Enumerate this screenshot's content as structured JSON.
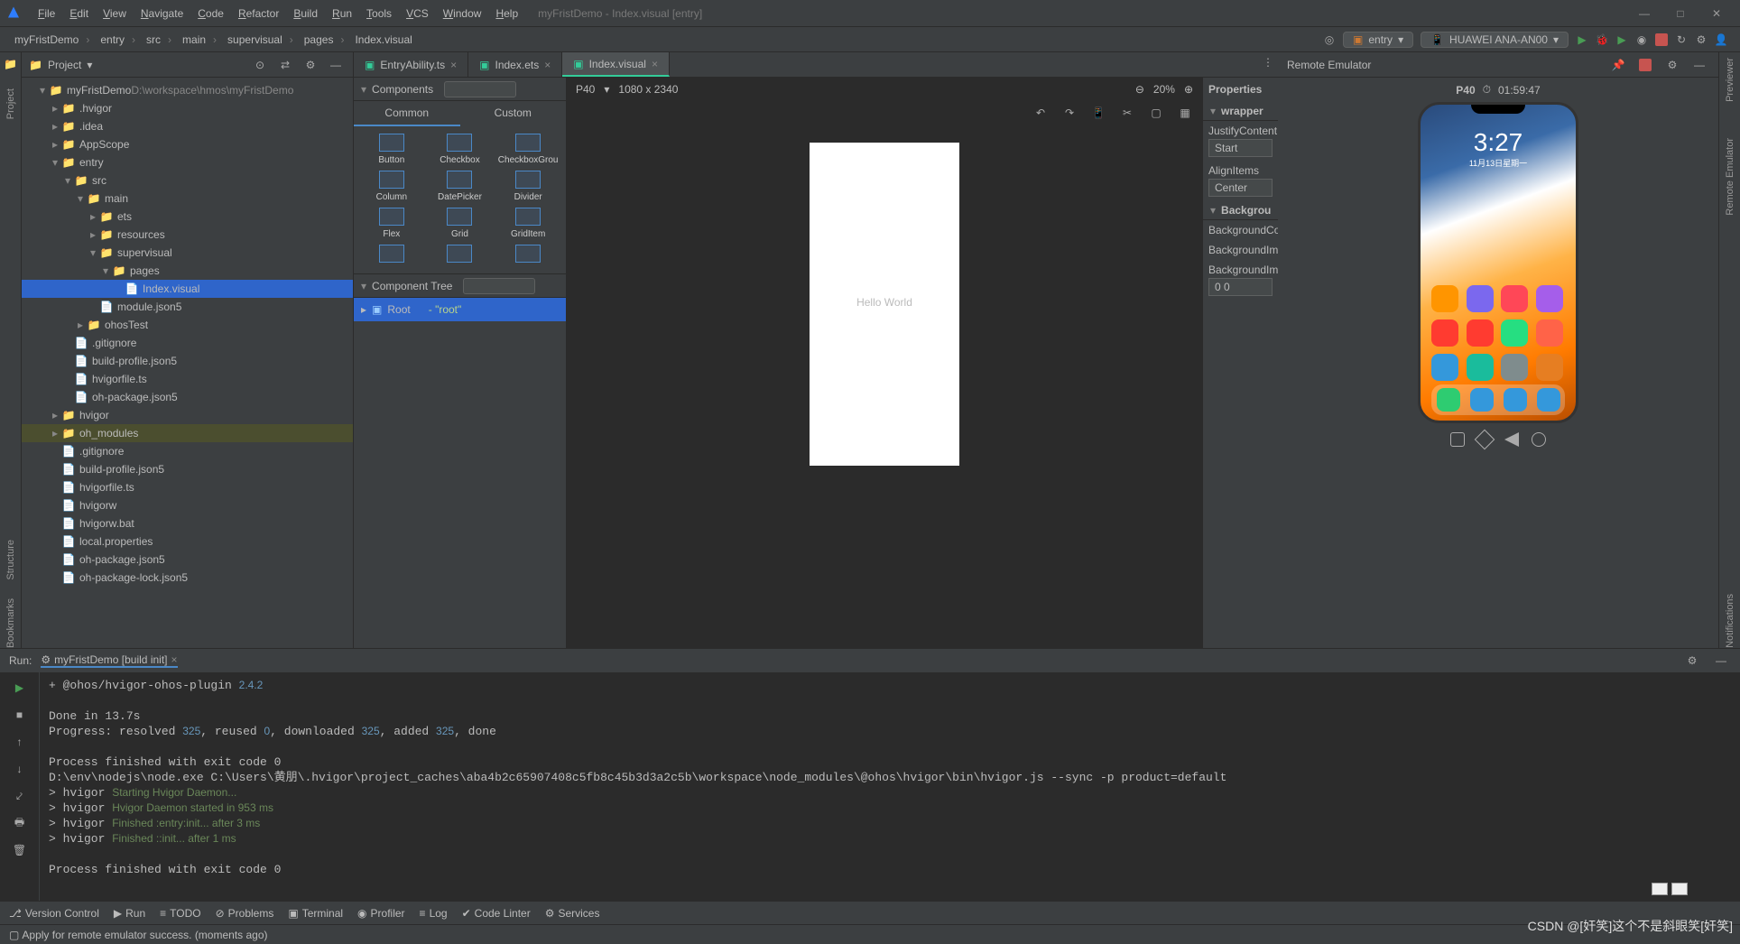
{
  "menubar": {
    "items": [
      "File",
      "Edit",
      "View",
      "Navigate",
      "Code",
      "Refactor",
      "Build",
      "Run",
      "Tools",
      "VCS",
      "Window",
      "Help"
    ],
    "title": "myFristDemo - Index.visual [entry]"
  },
  "breadcrumbs": [
    "myFristDemo",
    "entry",
    "src",
    "main",
    "supervisual",
    "pages",
    "Index.visual"
  ],
  "config": {
    "module": "entry",
    "device": "HUAWEI ANA-AN00"
  },
  "project": {
    "header": "Project",
    "rootLabel": "myFristDemo",
    "rootPath": "D:\\workspace\\hmos\\myFristDemo"
  },
  "tree": [
    {
      "d": 1,
      "tw": "▾",
      "ic": "📁",
      "cls": "c-blue",
      "t": "myFristDemo",
      "suffix": " D:\\workspace\\hmos\\myFristDemo"
    },
    {
      "d": 2,
      "tw": "▸",
      "ic": "📁",
      "t": ".hvigor"
    },
    {
      "d": 2,
      "tw": "▸",
      "ic": "📁",
      "t": ".idea"
    },
    {
      "d": 2,
      "tw": "▸",
      "ic": "📁",
      "t": "AppScope"
    },
    {
      "d": 2,
      "tw": "▾",
      "ic": "📁",
      "cls": "c-blue",
      "t": "entry"
    },
    {
      "d": 3,
      "tw": "▾",
      "ic": "📁",
      "t": "src"
    },
    {
      "d": 4,
      "tw": "▾",
      "ic": "📁",
      "t": "main"
    },
    {
      "d": 5,
      "tw": "▸",
      "ic": "📁",
      "t": "ets"
    },
    {
      "d": 5,
      "tw": "▸",
      "ic": "📁",
      "t": "resources"
    },
    {
      "d": 5,
      "tw": "▾",
      "ic": "📁",
      "t": "supervisual"
    },
    {
      "d": 6,
      "tw": "▾",
      "ic": "📁",
      "t": "pages"
    },
    {
      "d": 7,
      "tw": "",
      "ic": "📄",
      "cls": "c-teal",
      "t": "Index.visual",
      "sel": true
    },
    {
      "d": 5,
      "tw": "",
      "ic": "📄",
      "cls": "c-orange",
      "t": "module.json5"
    },
    {
      "d": 4,
      "tw": "▸",
      "ic": "📁",
      "t": "ohosTest"
    },
    {
      "d": 3,
      "tw": "",
      "ic": "📄",
      "t": ".gitignore"
    },
    {
      "d": 3,
      "tw": "",
      "ic": "📄",
      "cls": "c-orange",
      "t": "build-profile.json5"
    },
    {
      "d": 3,
      "tw": "",
      "ic": "📄",
      "cls": "c-teal",
      "t": "hvigorfile.ts"
    },
    {
      "d": 3,
      "tw": "",
      "ic": "📄",
      "cls": "c-orange",
      "t": "oh-package.json5"
    },
    {
      "d": 2,
      "tw": "▸",
      "ic": "📁",
      "t": "hvigor"
    },
    {
      "d": 2,
      "tw": "▸",
      "ic": "📁",
      "cls": "c-orange",
      "t": "oh_modules",
      "hl": true
    },
    {
      "d": 2,
      "tw": "",
      "ic": "📄",
      "t": ".gitignore"
    },
    {
      "d": 2,
      "tw": "",
      "ic": "📄",
      "cls": "c-orange",
      "t": "build-profile.json5"
    },
    {
      "d": 2,
      "tw": "",
      "ic": "📄",
      "cls": "c-teal",
      "t": "hvigorfile.ts"
    },
    {
      "d": 2,
      "tw": "",
      "ic": "📄",
      "t": "hvigorw"
    },
    {
      "d": 2,
      "tw": "",
      "ic": "📄",
      "t": "hvigorw.bat"
    },
    {
      "d": 2,
      "tw": "",
      "ic": "📄",
      "t": "local.properties"
    },
    {
      "d": 2,
      "tw": "",
      "ic": "📄",
      "cls": "c-orange",
      "t": "oh-package.json5"
    },
    {
      "d": 2,
      "tw": "",
      "ic": "📄",
      "cls": "c-orange",
      "t": "oh-package-lock.json5"
    }
  ],
  "editorTabs": [
    {
      "t": "EntryAbility.ts"
    },
    {
      "t": "Index.ets"
    },
    {
      "t": "Index.visual",
      "active": true
    }
  ],
  "components": {
    "header": "Components",
    "tabs": [
      "Common",
      "Custom"
    ],
    "items": [
      "Button",
      "Checkbox",
      "CheckboxGrou",
      "Column",
      "DatePicker",
      "Divider",
      "Flex",
      "Grid",
      "GridItem",
      "",
      "",
      ""
    ]
  },
  "componentTree": {
    "header": "Component Tree",
    "root": "Root",
    "rootHint": "- \"root\""
  },
  "canvas": {
    "device": "P40",
    "resolution": "1080 x 2340",
    "zoom": "20%",
    "text": "Hello World"
  },
  "properties": {
    "header": "Properties",
    "section": "wrapper",
    "items": [
      {
        "k": "JustifyContent",
        "v": "Start"
      },
      {
        "k": "AlignItems",
        "v": "Center"
      }
    ],
    "bg": {
      "header": "Backgrou",
      "items": [
        "BackgroundCo",
        "BackgroundIm",
        "BackgroundIm"
      ],
      "val": "0 0"
    }
  },
  "emulator": {
    "header": "Remote Emulator",
    "device": "P40",
    "timer": "01:59:47",
    "lockTime": "3:27",
    "lockDate": "11月13日星期一"
  },
  "appColors": [
    "#ff9500",
    "#7b68ee",
    "#ff4757",
    "#a55eea",
    "#ff3b30",
    "#ff3b30",
    "#26de81",
    "#ff6348",
    "#3498db",
    "#1abc9c",
    "#7f8c8d",
    "#e67e22"
  ],
  "dockColors": [
    "#2ecc71",
    "#3498db",
    "#3498db",
    "#3498db"
  ],
  "run": {
    "header": "Run:",
    "tab": "myFristDemo [build init]"
  },
  "consoleLines": [
    {
      "pre": "+ @ohos/hvigor-ohos-plugin ",
      "num": "2.4.2"
    },
    {
      "pre": ""
    },
    {
      "pre": "Done in 13.7s"
    },
    {
      "pre": "Progress: resolved ",
      "seg": [
        [
          "325",
          "n"
        ],
        [
          ", reused ",
          ""
        ],
        [
          "0",
          "n"
        ],
        [
          ", downloaded ",
          ""
        ],
        [
          "325",
          "n"
        ],
        [
          ", added ",
          ""
        ],
        [
          "325",
          "n"
        ],
        [
          ", done",
          ""
        ]
      ]
    },
    {
      "pre": ""
    },
    {
      "pre": "Process finished with exit code 0"
    },
    {
      "pre": "D:\\env\\nodejs\\node.exe C:\\Users\\黄朋\\.hvigor\\project_caches\\aba4b2c65907408c5fb8c45b3d3a2c5b\\workspace\\node_modules\\@ohos\\hvigor\\bin\\hvigor.js --sync -p product=default"
    },
    {
      "pre": "> hvigor ",
      "g": "Starting Hvigor Daemon..."
    },
    {
      "pre": "> hvigor ",
      "g": "Hvigor Daemon started in 953 ms"
    },
    {
      "pre": "> hvigor ",
      "g": "Finished :entry:init... after 3 ms"
    },
    {
      "pre": "> hvigor ",
      "g": "Finished ::init... after 1 ms"
    },
    {
      "pre": ""
    },
    {
      "pre": "Process finished with exit code 0"
    }
  ],
  "bottomTabs": [
    {
      "t": "Version Control",
      "i": "⎇"
    },
    {
      "t": "Run",
      "i": "▶",
      "active": true
    },
    {
      "t": "TODO",
      "i": "≡"
    },
    {
      "t": "Problems",
      "i": "⊘"
    },
    {
      "t": "Terminal",
      "i": "▣"
    },
    {
      "t": "Profiler",
      "i": "◉"
    },
    {
      "t": "Log",
      "i": "≡"
    },
    {
      "t": "Code Linter",
      "i": "✔"
    },
    {
      "t": "Services",
      "i": "⚙"
    }
  ],
  "status": "Apply for remote emulator success. (moments ago)",
  "watermark": "CSDN @[奸笑]这个不是斜眼笑[奸笑]",
  "rails": {
    "left": "Project",
    "right1": "Previewer",
    "right2": "Remote Emulator",
    "leftBottom": [
      "Structure",
      "Bookmarks"
    ],
    "rightBottom": "Notifications"
  }
}
